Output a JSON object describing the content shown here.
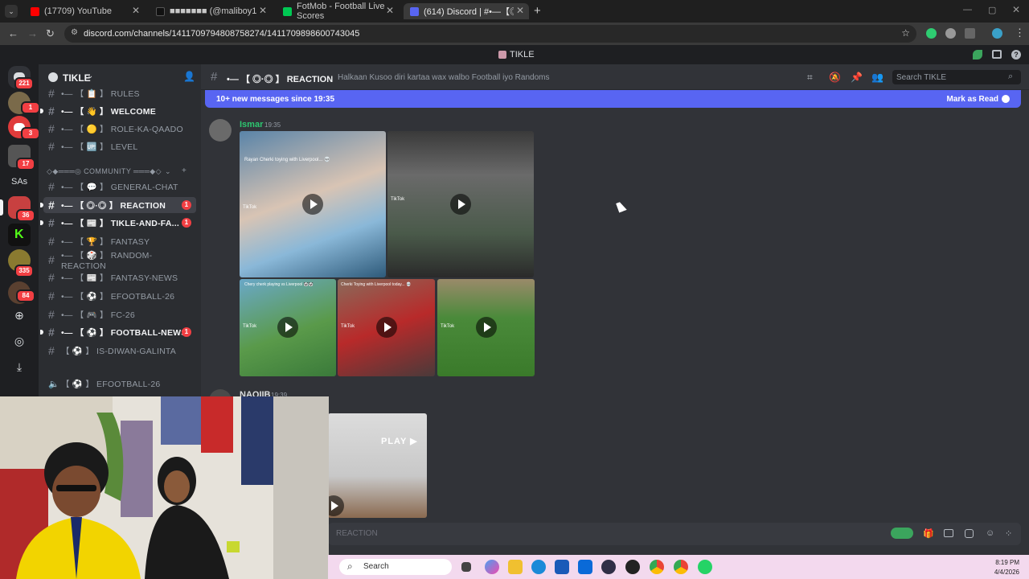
{
  "browser": {
    "tabs": [
      {
        "label": "(17709) YouTube",
        "color": "#ff0000"
      },
      {
        "label": "■■■■■■■ (@maliboy1...",
        "color": "#111111"
      },
      {
        "label": "FotMob - Football Live Scores",
        "color": "#00c853"
      },
      {
        "label": "(614) Discord | #•—【◎·◎】RE...",
        "color": "#5865f2"
      }
    ],
    "new_tab": "+",
    "url": "discord.com/channels/1411709794808758274/1411709898600743045"
  },
  "app_title": "TIKLE",
  "rail": {
    "badges": [
      "221",
      "1",
      "3",
      "17",
      "36",
      "335",
      "84"
    ],
    "text_server": "SAs"
  },
  "server": {
    "name": "TIKLE",
    "category": "◇◆═══◎ COMMUNITY ═══◆◇",
    "channels": [
      {
        "label": "•— 【 📋 】 RULES",
        "unread": false,
        "badge": ""
      },
      {
        "label": "•— 【 👋 】 WELCOME",
        "unread": true,
        "badge": ""
      },
      {
        "label": "•— 【 🟡 】 ROLE-KA-QAADO",
        "unread": false,
        "badge": ""
      },
      {
        "label": "•— 【 🆙 】 LEVEL",
        "unread": false,
        "badge": ""
      },
      {
        "label": "•— 【 💬 】 GENERAL-CHAT",
        "unread": false,
        "badge": ""
      },
      {
        "label": "•— 【 ◎·◎ 】 REACTION",
        "unread": true,
        "badge": "1",
        "selected": true
      },
      {
        "label": "•— 【 📰 】 TIKLE-AND-FA...",
        "unread": true,
        "badge": "1"
      },
      {
        "label": "•— 【 🏆 】 FANTASY",
        "unread": false,
        "badge": ""
      },
      {
        "label": "•— 【 🎲 】 RANDOM-REACTION",
        "unread": false,
        "badge": ""
      },
      {
        "label": "•— 【 📰 】 FANTASY-NEWS",
        "unread": false,
        "badge": ""
      },
      {
        "label": "•— 【 ⚽ 】 EFOOTBALL-26",
        "unread": false,
        "badge": ""
      },
      {
        "label": "•— 【 🎮 】 FC-26",
        "unread": false,
        "badge": ""
      },
      {
        "label": "•— 【 ⚽ 】 FOOTBALL-NEWS",
        "unread": true,
        "badge": "1"
      },
      {
        "label": "【 ⚽ 】 IS-DIWAN-GALINTA",
        "unread": false,
        "badge": ""
      }
    ],
    "voice_channel": "【 ⚽ 】 EFOOTBALL-26"
  },
  "channel_header": {
    "name": "•— 【 ◎·◎ 】 REACTION",
    "topic": "Halkaan Kusoo diri kartaa wax walbo Football iyo Randoms",
    "search_placeholder": "Search TIKLE"
  },
  "new_messages": {
    "text": "10+ new messages since 19:35",
    "action": "Mark as Read"
  },
  "messages": [
    {
      "author": "Ismar",
      "author_color": "#2dc770",
      "time": "19:35",
      "captions": [
        "Rayan Cherki toying with Liverpool... 💀",
        "Cherki Toying with Liverpool today... 💀",
        "Chery cherk playing vs Liverpool 🐼🐼"
      ],
      "tiktok": "TikTok"
    },
    {
      "author": "NAQIIB",
      "author_color": "#dbdee1",
      "time": "19:39",
      "overlay": "PLAY ▶"
    }
  ],
  "input_placeholder": "REACTION",
  "taskbar": {
    "search": "Search",
    "time": "8:19 PM",
    "date": "4/4/2026"
  }
}
